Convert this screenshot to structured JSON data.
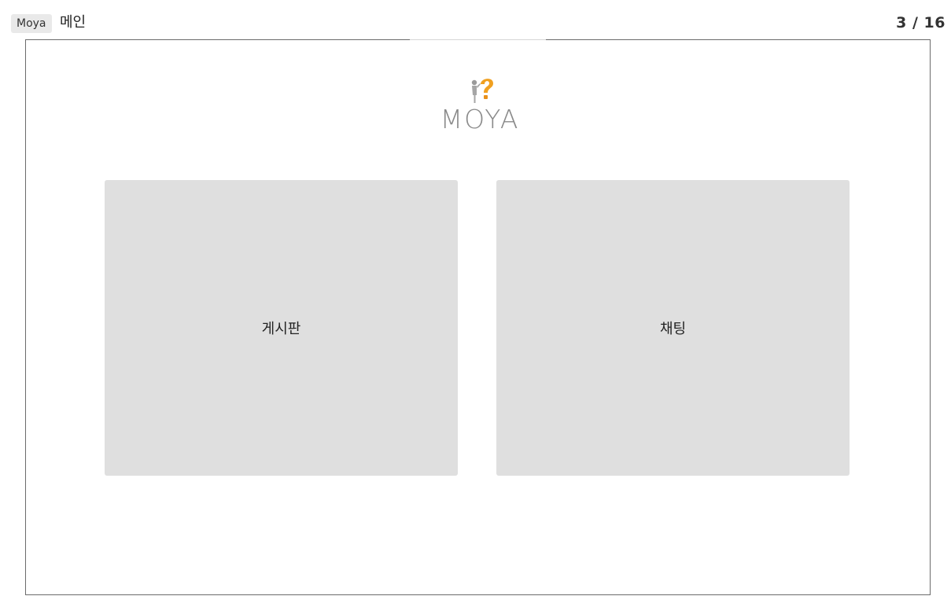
{
  "header": {
    "app_tag": "Moya",
    "page_name": "메인",
    "page_counter": "3 / 16"
  },
  "logo": {
    "text": "MOYA",
    "icon": "question-mark-figure-icon",
    "accent_color": "#f0a020"
  },
  "cards": {
    "board_label": "게시판",
    "chat_label": "채팅"
  },
  "colors": {
    "card_bg": "#dfdfdf",
    "frame_border": "#6b6b6b"
  }
}
